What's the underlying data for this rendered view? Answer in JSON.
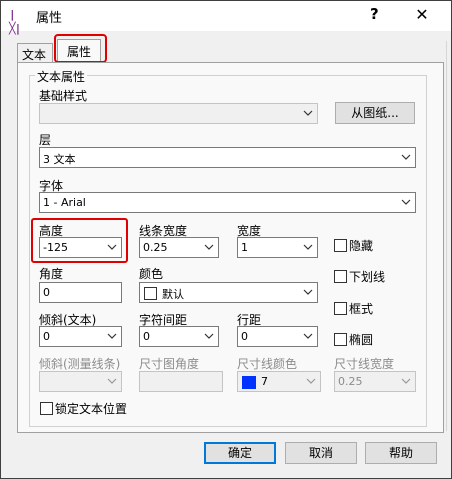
{
  "window": {
    "icon_text": "|╳|",
    "title": "属性",
    "help_label": "?",
    "close_label": "✕"
  },
  "tabs": [
    {
      "label": "文本"
    },
    {
      "label": "属性"
    }
  ],
  "group_title": "文本属性",
  "base_style": {
    "label": "基础样式",
    "value": "",
    "button": "从图纸..."
  },
  "layer": {
    "label": "层",
    "value": "3 文本"
  },
  "font": {
    "label": "字体",
    "value": "1 - Arial"
  },
  "height": {
    "label": "高度",
    "value": "-125"
  },
  "line_width": {
    "label": "线条宽度",
    "value": "0.25"
  },
  "width": {
    "label": "宽度",
    "value": "1"
  },
  "angle": {
    "label": "角度",
    "value": "0"
  },
  "color": {
    "label": "颜色",
    "value": "默认"
  },
  "slant": {
    "label": "倾斜(文本)",
    "value": "0"
  },
  "char_spacing": {
    "label": "字符间距",
    "value": "0"
  },
  "line_spacing": {
    "label": "行距",
    "value": "0"
  },
  "slant_dim": {
    "label": "倾斜(测量线条)",
    "value": ""
  },
  "dim_angle": {
    "label": "尺寸图角度",
    "value": ""
  },
  "dim_line_color": {
    "label": "尺寸线颜色",
    "value": "7"
  },
  "dim_line_width": {
    "label": "尺寸线宽度",
    "value": "0.25"
  },
  "checkboxes": {
    "hidden": "隐藏",
    "underline": "下划线",
    "frame": "框式",
    "ellipse": "椭圆",
    "lock_pos": "锁定文本位置"
  },
  "buttons": {
    "ok": "确定",
    "cancel": "取消",
    "help": "帮助"
  },
  "colors": {
    "highlight": "#e00000",
    "dim_color_swatch": "#0033ff",
    "default_button": "#0078d7"
  }
}
